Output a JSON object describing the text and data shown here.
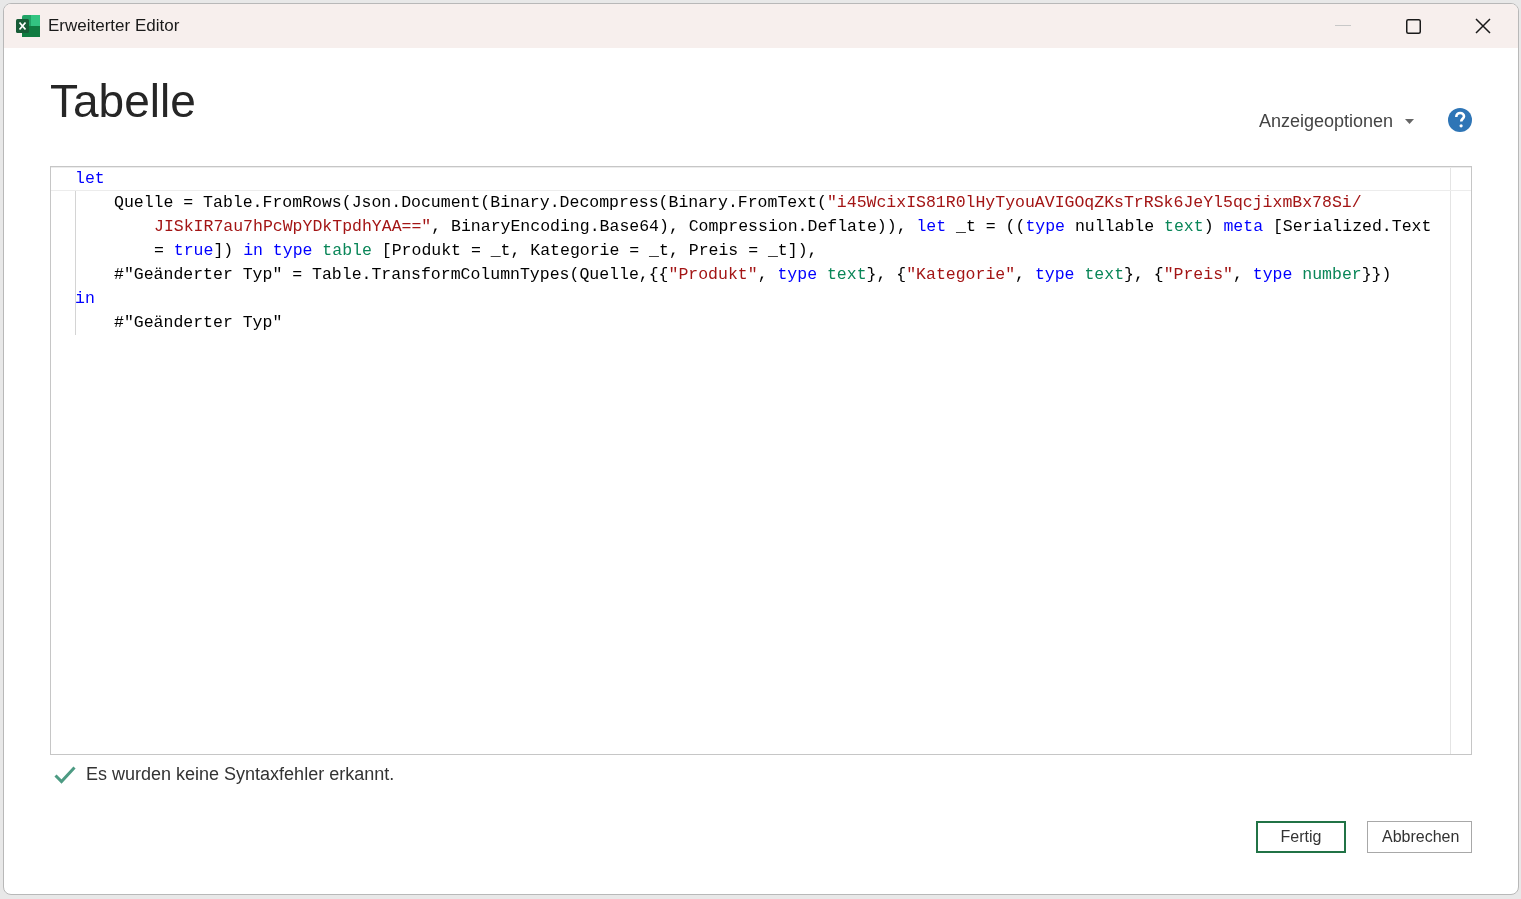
{
  "window": {
    "title": "Erweiterter Editor"
  },
  "heading": "Tabelle",
  "display_options": {
    "label": "Anzeigeoptionen"
  },
  "editor": {
    "lines": [
      {
        "kind": "top",
        "tokens": [
          {
            "kind": "kw",
            "t": "let"
          }
        ]
      },
      {
        "kind": "body",
        "tokens": [
          {
            "kind": "plain",
            "t": "Quelle = Table.FromRows(Json.Document(Binary.Decompress(Binary.FromText("
          },
          {
            "kind": "str",
            "t": "\"i45WcixIS81R0lHyTyouAVIGOqZKsTrRSk6JeYl5qcjixmBx78Si/"
          }
        ]
      },
      {
        "kind": "cont",
        "tokens": [
          {
            "kind": "str",
            "t": "JISkIR7au7hPcWpYDkTpdhYAA==\""
          },
          {
            "kind": "plain",
            "t": ", BinaryEncoding.Base64), Compression.Deflate)), "
          },
          {
            "kind": "kw",
            "t": "let"
          },
          {
            "kind": "plain",
            "t": " _t = (("
          },
          {
            "kind": "kw",
            "t": "type"
          },
          {
            "kind": "plain",
            "t": " nullable "
          },
          {
            "kind": "type",
            "t": "text"
          },
          {
            "kind": "plain",
            "t": ") "
          },
          {
            "kind": "kw",
            "t": "meta"
          },
          {
            "kind": "plain",
            "t": " [Serialized.Text"
          }
        ]
      },
      {
        "kind": "cont",
        "tokens": [
          {
            "kind": "plain",
            "t": "= "
          },
          {
            "kind": "kw",
            "t": "true"
          },
          {
            "kind": "plain",
            "t": "]) "
          },
          {
            "kind": "kw",
            "t": "in type "
          },
          {
            "kind": "type",
            "t": "table"
          },
          {
            "kind": "plain",
            "t": " [Produkt = _t, Kategorie = _t, Preis = _t]),"
          }
        ]
      },
      {
        "kind": "body",
        "tokens": [
          {
            "kind": "plain",
            "t": "#\"Geänderter Typ\" = Table.TransformColumnTypes(Quelle,{{"
          },
          {
            "kind": "str",
            "t": "\"Produkt\""
          },
          {
            "kind": "plain",
            "t": ", "
          },
          {
            "kind": "kw",
            "t": "type "
          },
          {
            "kind": "type",
            "t": "text"
          },
          {
            "kind": "plain",
            "t": "}, {"
          },
          {
            "kind": "str",
            "t": "\"Kategorie\""
          },
          {
            "kind": "plain",
            "t": ", "
          },
          {
            "kind": "kw",
            "t": "type "
          },
          {
            "kind": "type",
            "t": "text"
          },
          {
            "kind": "plain",
            "t": "}, {"
          },
          {
            "kind": "str",
            "t": "\"Preis\""
          },
          {
            "kind": "plain",
            "t": ", "
          },
          {
            "kind": "kw",
            "t": "type "
          },
          {
            "kind": "type",
            "t": "number"
          },
          {
            "kind": "plain",
            "t": "}})"
          }
        ]
      },
      {
        "kind": "top",
        "tokens": [
          {
            "kind": "kw",
            "t": "in"
          }
        ]
      },
      {
        "kind": "body",
        "tokens": [
          {
            "kind": "plain",
            "t": "#\"Geänderter Typ\""
          }
        ]
      }
    ]
  },
  "status": {
    "text": "Es wurden keine Syntaxfehler erkannt."
  },
  "buttons": [
    {
      "label": "Fertig",
      "kind": "primary"
    },
    {
      "label": "Abbrechen",
      "kind": "secondary"
    }
  ]
}
